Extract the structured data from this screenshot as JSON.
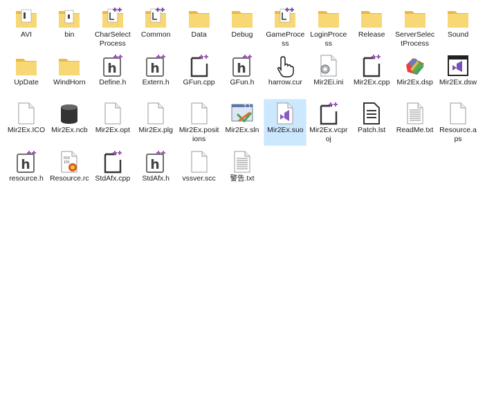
{
  "files": [
    {
      "name": "AVI",
      "icon": "folder-icon",
      "kind": "folder-doc"
    },
    {
      "name": "bin",
      "icon": "folder-icon",
      "kind": "folder-doc2"
    },
    {
      "name": "CharSelectProcess",
      "icon": "folder-icon",
      "kind": "folder-cpp"
    },
    {
      "name": "Common",
      "icon": "folder-icon",
      "kind": "folder-cpp"
    },
    {
      "name": "Data",
      "icon": "folder-icon",
      "kind": "folder"
    },
    {
      "name": "Debug",
      "icon": "folder-icon",
      "kind": "folder"
    },
    {
      "name": "GameProcess",
      "icon": "folder-icon",
      "kind": "folder-cpp"
    },
    {
      "name": "LoginProcess",
      "icon": "folder-icon",
      "kind": "folder"
    },
    {
      "name": "Release",
      "icon": "folder-icon",
      "kind": "folder"
    },
    {
      "name": "ServerSelectProcess",
      "icon": "folder-icon",
      "kind": "folder"
    },
    {
      "name": "Sound",
      "icon": "folder-icon",
      "kind": "folder"
    },
    {
      "name": "UpDate",
      "icon": "folder-icon",
      "kind": "folder"
    },
    {
      "name": "WindHorn",
      "icon": "folder-icon",
      "kind": "folder"
    },
    {
      "name": "Define.h",
      "icon": "header-file-icon",
      "kind": "h"
    },
    {
      "name": "Extern.h",
      "icon": "header-file-icon",
      "kind": "h"
    },
    {
      "name": "GFun.cpp",
      "icon": "cpp-file-icon",
      "kind": "cpp"
    },
    {
      "name": "GFun.h",
      "icon": "header-file-icon",
      "kind": "h"
    },
    {
      "name": "harrow.cur",
      "icon": "cursor-file-icon",
      "kind": "cur"
    },
    {
      "name": "Mir2Ei.ini",
      "icon": "ini-file-icon",
      "kind": "ini"
    },
    {
      "name": "Mir2Ex.cpp",
      "icon": "cpp-file-icon",
      "kind": "cpp"
    },
    {
      "name": "Mir2Ex.dsp",
      "icon": "dsp-file-icon",
      "kind": "dsp"
    },
    {
      "name": "Mir2Ex.dsw",
      "icon": "visual-studio-icon",
      "kind": "dsw"
    },
    {
      "name": "Mir2Ex.ICO",
      "icon": "blank-file-icon",
      "kind": "blank"
    },
    {
      "name": "Mir2Ex.ncb",
      "icon": "database-icon",
      "kind": "ncb"
    },
    {
      "name": "Mir2Ex.opt",
      "icon": "blank-file-icon",
      "kind": "blank"
    },
    {
      "name": "Mir2Ex.plg",
      "icon": "blank-file-icon",
      "kind": "blank"
    },
    {
      "name": "Mir2Ex.positions",
      "icon": "blank-file-icon",
      "kind": "blank"
    },
    {
      "name": "Mir2Ex.sln",
      "icon": "solution-file-icon",
      "kind": "sln"
    },
    {
      "name": "Mir2Ex.suo",
      "icon": "visual-studio-file-icon",
      "kind": "suo"
    },
    {
      "name": "Mir2Ex.vcproj",
      "icon": "cpp-file-icon",
      "kind": "cpp"
    },
    {
      "name": "Patch.lst",
      "icon": "list-file-icon",
      "kind": "lst"
    },
    {
      "name": "ReadMe.txt",
      "icon": "text-file-icon",
      "kind": "txt"
    },
    {
      "name": "Resource.aps",
      "icon": "blank-file-icon",
      "kind": "blank"
    },
    {
      "name": "resource.h",
      "icon": "header-file-icon",
      "kind": "h"
    },
    {
      "name": "Resource.rc",
      "icon": "resource-file-icon",
      "kind": "rc"
    },
    {
      "name": "StdAfx.cpp",
      "icon": "cpp-file-icon",
      "kind": "cpp"
    },
    {
      "name": "StdAfx.h",
      "icon": "header-file-icon",
      "kind": "h"
    },
    {
      "name": "vssver.scc",
      "icon": "blank-file-icon",
      "kind": "blank"
    },
    {
      "name": "警告.txt",
      "icon": "text-file-icon",
      "kind": "txt"
    }
  ]
}
